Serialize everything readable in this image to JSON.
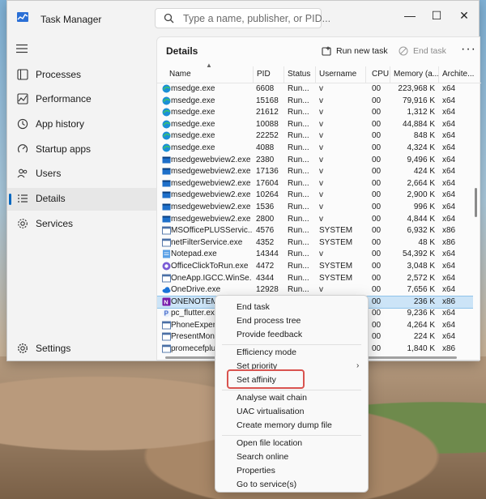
{
  "window": {
    "title": "Task Manager",
    "search_placeholder": "Type a name, publisher, or PID...",
    "minimize": "—",
    "maximize": "☐",
    "close": "✕"
  },
  "nav": {
    "items": [
      {
        "label": "Processes",
        "icon": "processes-icon"
      },
      {
        "label": "Performance",
        "icon": "performance-icon"
      },
      {
        "label": "App history",
        "icon": "app-history-icon"
      },
      {
        "label": "Startup apps",
        "icon": "startup-apps-icon"
      },
      {
        "label": "Users",
        "icon": "users-icon"
      },
      {
        "label": "Details",
        "icon": "details-icon",
        "active": true
      },
      {
        "label": "Services",
        "icon": "services-icon"
      }
    ],
    "settings": "Settings"
  },
  "panel": {
    "title": "Details",
    "run_new_task": "Run new task",
    "end_task": "End task",
    "more": "···",
    "columns": [
      "Name",
      "PID",
      "Status",
      "Username",
      "CPU",
      "Memory (a...",
      "Archite..."
    ]
  },
  "rows": [
    {
      "name": "msedge.exe",
      "pid": "6608",
      "status": "Run...",
      "user": "v",
      "cpu": "00",
      "mem": "223,968 K",
      "arch": "x64",
      "icon": "edge"
    },
    {
      "name": "msedge.exe",
      "pid": "15168",
      "status": "Run...",
      "user": "v",
      "cpu": "00",
      "mem": "79,916 K",
      "arch": "x64",
      "icon": "edge"
    },
    {
      "name": "msedge.exe",
      "pid": "21612",
      "status": "Run...",
      "user": "v",
      "cpu": "00",
      "mem": "1,312 K",
      "arch": "x64",
      "icon": "edge"
    },
    {
      "name": "msedge.exe",
      "pid": "10088",
      "status": "Run...",
      "user": "v",
      "cpu": "00",
      "mem": "44,884 K",
      "arch": "x64",
      "icon": "edge"
    },
    {
      "name": "msedge.exe",
      "pid": "22252",
      "status": "Run...",
      "user": "v",
      "cpu": "00",
      "mem": "848 K",
      "arch": "x64",
      "icon": "edge"
    },
    {
      "name": "msedge.exe",
      "pid": "4088",
      "status": "Run...",
      "user": "v",
      "cpu": "00",
      "mem": "4,324 K",
      "arch": "x64",
      "icon": "edge"
    },
    {
      "name": "msedgewebview2.exe",
      "pid": "2380",
      "status": "Run...",
      "user": "v",
      "cpu": "00",
      "mem": "9,496 K",
      "arch": "x64",
      "icon": "webview"
    },
    {
      "name": "msedgewebview2.exe",
      "pid": "17136",
      "status": "Run...",
      "user": "v",
      "cpu": "00",
      "mem": "424 K",
      "arch": "x64",
      "icon": "webview"
    },
    {
      "name": "msedgewebview2.exe",
      "pid": "17604",
      "status": "Run...",
      "user": "v",
      "cpu": "00",
      "mem": "2,664 K",
      "arch": "x64",
      "icon": "webview"
    },
    {
      "name": "msedgewebview2.exe",
      "pid": "10264",
      "status": "Run...",
      "user": "v",
      "cpu": "00",
      "mem": "2,900 K",
      "arch": "x64",
      "icon": "webview"
    },
    {
      "name": "msedgewebview2.exe",
      "pid": "1536",
      "status": "Run...",
      "user": "v",
      "cpu": "00",
      "mem": "996 K",
      "arch": "x64",
      "icon": "webview"
    },
    {
      "name": "msedgewebview2.exe",
      "pid": "2800",
      "status": "Run...",
      "user": "v",
      "cpu": "00",
      "mem": "4,844 K",
      "arch": "x64",
      "icon": "webview"
    },
    {
      "name": "MSOfficePLUSServic...",
      "pid": "4576",
      "status": "Run...",
      "user": "SYSTEM",
      "cpu": "00",
      "mem": "6,932 K",
      "arch": "x86",
      "icon": "generic"
    },
    {
      "name": "netFilterService.exe",
      "pid": "4352",
      "status": "Run...",
      "user": "SYSTEM",
      "cpu": "00",
      "mem": "48 K",
      "arch": "x86",
      "icon": "generic"
    },
    {
      "name": "Notepad.exe",
      "pid": "14344",
      "status": "Run...",
      "user": "v",
      "cpu": "00",
      "mem": "54,392 K",
      "arch": "x64",
      "icon": "notepad"
    },
    {
      "name": "OfficeClickToRun.exe",
      "pid": "4472",
      "status": "Run...",
      "user": "SYSTEM",
      "cpu": "00",
      "mem": "3,048 K",
      "arch": "x64",
      "icon": "office"
    },
    {
      "name": "OneApp.IGCC.WinSe...",
      "pid": "4344",
      "status": "Run...",
      "user": "SYSTEM",
      "cpu": "00",
      "mem": "2,572 K",
      "arch": "x64",
      "icon": "generic"
    },
    {
      "name": "OneDrive.exe",
      "pid": "12928",
      "status": "Run...",
      "user": "v",
      "cpu": "00",
      "mem": "7,656 K",
      "arch": "x64",
      "icon": "onedrive"
    },
    {
      "name": "ONENOTEM.EXE",
      "pid": "",
      "status": "",
      "user": "",
      "cpu": "00",
      "mem": "236 K",
      "arch": "x86",
      "icon": "onenote",
      "selected": true
    },
    {
      "name": "pc_flutter.exe",
      "pid": "",
      "status": "",
      "user": "",
      "cpu": "00",
      "mem": "9,236 K",
      "arch": "x64",
      "icon": "flutter"
    },
    {
      "name": "PhoneExperie",
      "pid": "",
      "status": "",
      "user": "",
      "cpu": "00",
      "mem": "4,264 K",
      "arch": "x64",
      "icon": "generic"
    },
    {
      "name": "PresentMonS",
      "pid": "",
      "status": "",
      "user": "",
      "cpu": "00",
      "mem": "224 K",
      "arch": "x64",
      "icon": "generic"
    },
    {
      "name": "promecefplug",
      "pid": "",
      "status": "",
      "user": "",
      "cpu": "00",
      "mem": "1,840 K",
      "arch": "x86",
      "icon": "generic"
    }
  ],
  "context_menu": {
    "groups": [
      [
        "End task",
        "End process tree",
        "Provide feedback"
      ],
      [
        "Efficiency mode",
        "Set priority",
        "Set affinity"
      ],
      [
        "Analyse wait chain",
        "UAC virtualisation",
        "Create memory dump file"
      ],
      [
        "Open file location",
        "Search online",
        "Properties",
        "Go to service(s)"
      ]
    ]
  },
  "colors": {
    "accent": "#0067c0",
    "selection": "#cce4f7",
    "highlight_box": "#d9534f"
  }
}
